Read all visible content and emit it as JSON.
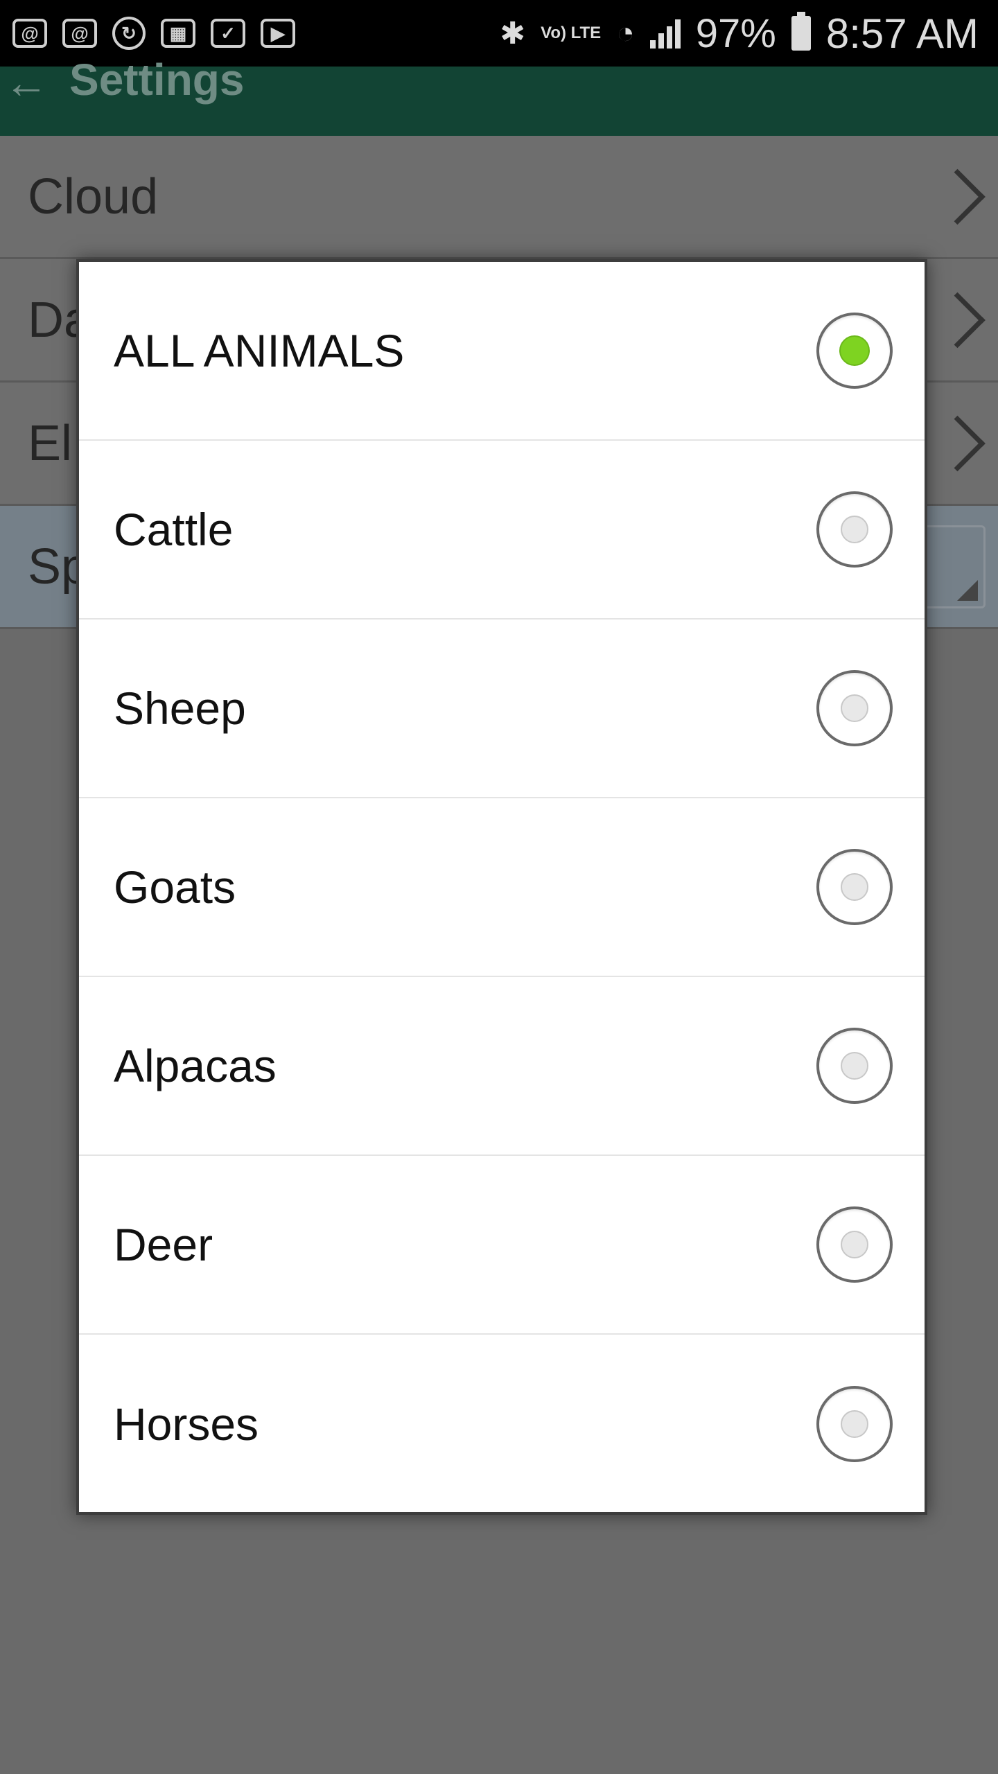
{
  "status_bar": {
    "left_icons": [
      "email-icon",
      "email-alt-icon",
      "sync-icon",
      "film-icon",
      "clipboard-icon",
      "briefcase-icon"
    ],
    "signal_label": "Vo) LTE",
    "battery": "97%",
    "time": "8:57 AM"
  },
  "app_bar": {
    "back": "←",
    "title": "Settings"
  },
  "settings": {
    "rows": [
      {
        "label": "Cloud"
      },
      {
        "label": "Da"
      },
      {
        "label": "El"
      },
      {
        "label": "Sp"
      }
    ]
  },
  "dialog": {
    "options": [
      {
        "label": "ALL ANIMALS",
        "selected": true
      },
      {
        "label": "Cattle",
        "selected": false
      },
      {
        "label": "Sheep",
        "selected": false
      },
      {
        "label": "Goats",
        "selected": false
      },
      {
        "label": "Alpacas",
        "selected": false
      },
      {
        "label": "Deer",
        "selected": false
      },
      {
        "label": "Horses",
        "selected": false
      }
    ]
  },
  "colors": {
    "app_bar": "#124434",
    "radio_selected": "#7ed321",
    "overlay": "#6a6a6a"
  }
}
